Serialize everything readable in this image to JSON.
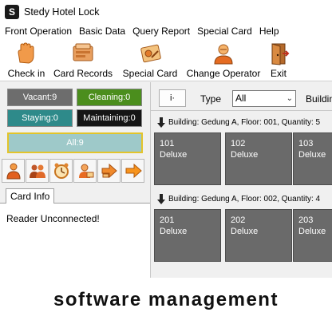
{
  "window": {
    "title": "Stedy Hotel Lock",
    "app_icon": "S"
  },
  "menu": [
    "Front Operation",
    "Basic Data",
    "Query Report",
    "Special Card",
    "Help"
  ],
  "toolbar": {
    "checkin": "Check in",
    "records": "Card Records",
    "special": "Special Card",
    "operator": "Change Operator",
    "exit": "Exit"
  },
  "status": {
    "vacant": "Vacant:9",
    "cleaning": "Cleaning:0",
    "staying": "Staying:0",
    "maintaining": "Maintaining:0",
    "all": "All:9",
    "colors": {
      "vacant": "#6d6d6d",
      "cleaning": "#4b8e1d",
      "staying": "#2e8a8a",
      "maintaining": "#151515",
      "all": "#9ec9c9"
    }
  },
  "icons": [
    "person-icon",
    "group-icon",
    "clock-icon",
    "card-person-icon",
    "forward-arrow-icon",
    "arrow-right-icon"
  ],
  "tabs": {
    "card_info": "Card Info"
  },
  "card_info": {
    "reader_status": "Reader Unconnected!"
  },
  "filter": {
    "button": "i·",
    "type_label": "Type",
    "type_value": "All",
    "building_label": "Buildin"
  },
  "floors": [
    {
      "header": "Building: Gedung A, Floor: 001, Quantity: 5",
      "rooms": [
        {
          "number": "101",
          "type": "Deluxe"
        },
        {
          "number": "102",
          "type": "Deluxe"
        },
        {
          "number": "103",
          "type": "Deluxe"
        }
      ]
    },
    {
      "header": "Building: Gedung A, Floor: 002, Quantity: 4",
      "rooms": [
        {
          "number": "201",
          "type": "Deluxe"
        },
        {
          "number": "202",
          "type": "Deluxe"
        },
        {
          "number": "203",
          "type": "Deluxe"
        }
      ]
    }
  ],
  "caption": "software management"
}
